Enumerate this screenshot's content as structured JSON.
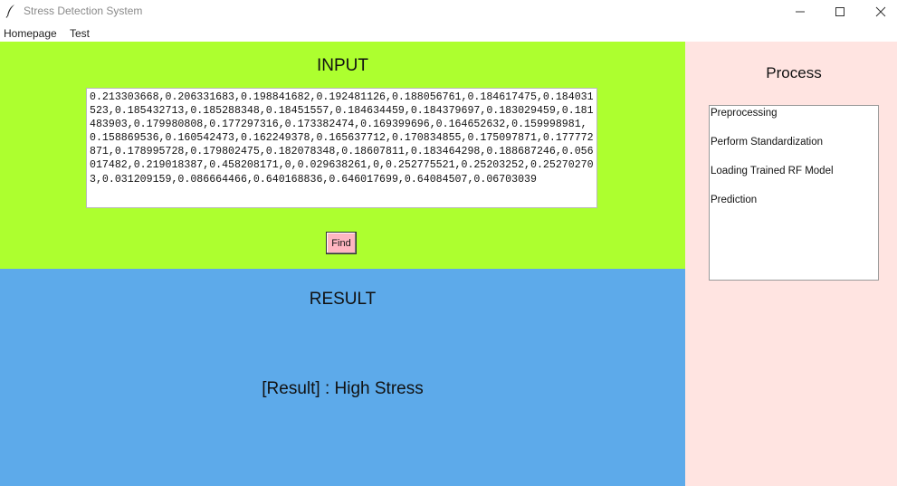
{
  "window": {
    "title": "Stress Detection System",
    "icon": "feather-icon"
  },
  "menu": {
    "items": [
      "Homepage",
      "Test"
    ]
  },
  "input": {
    "heading": "INPUT",
    "value": "0.213303668,0.206331683,0.198841682,0.192481126,0.188056761,0.184617475,0.184031523,0.185432713,0.185288348,0.18451557,0.184634459,0.184379697,0.183029459,0.181483903,0.179980808,0.177297316,0.173382474,0.169399696,0.164652632,0.159998981,0.158869536,0.160542473,0.162249378,0.165637712,0.170834855,0.175097871,0.177772871,0.178995728,0.179802475,0.182078348,0.18607811,0.183464298,0.188687246,0.056017482,0.219018387,0.458208171,0,0.029638261,0,0.252775521,0.25203252,0.252702703,0.031209159,0.086664466,0.640168836,0.646017699,0.64084507,0.06703039",
    "find_label": "Find"
  },
  "result": {
    "heading": "RESULT",
    "text": "[Result] : High Stress"
  },
  "process": {
    "heading": "Process",
    "items": [
      "Preprocessing",
      "Perform Standardization",
      "Loading Trained RF Model",
      "Prediction"
    ]
  },
  "colors": {
    "input_bg": "#adff2f",
    "result_bg": "#5daaea",
    "process_bg": "#ffe4e1",
    "button_bg": "#ffb6c1"
  }
}
